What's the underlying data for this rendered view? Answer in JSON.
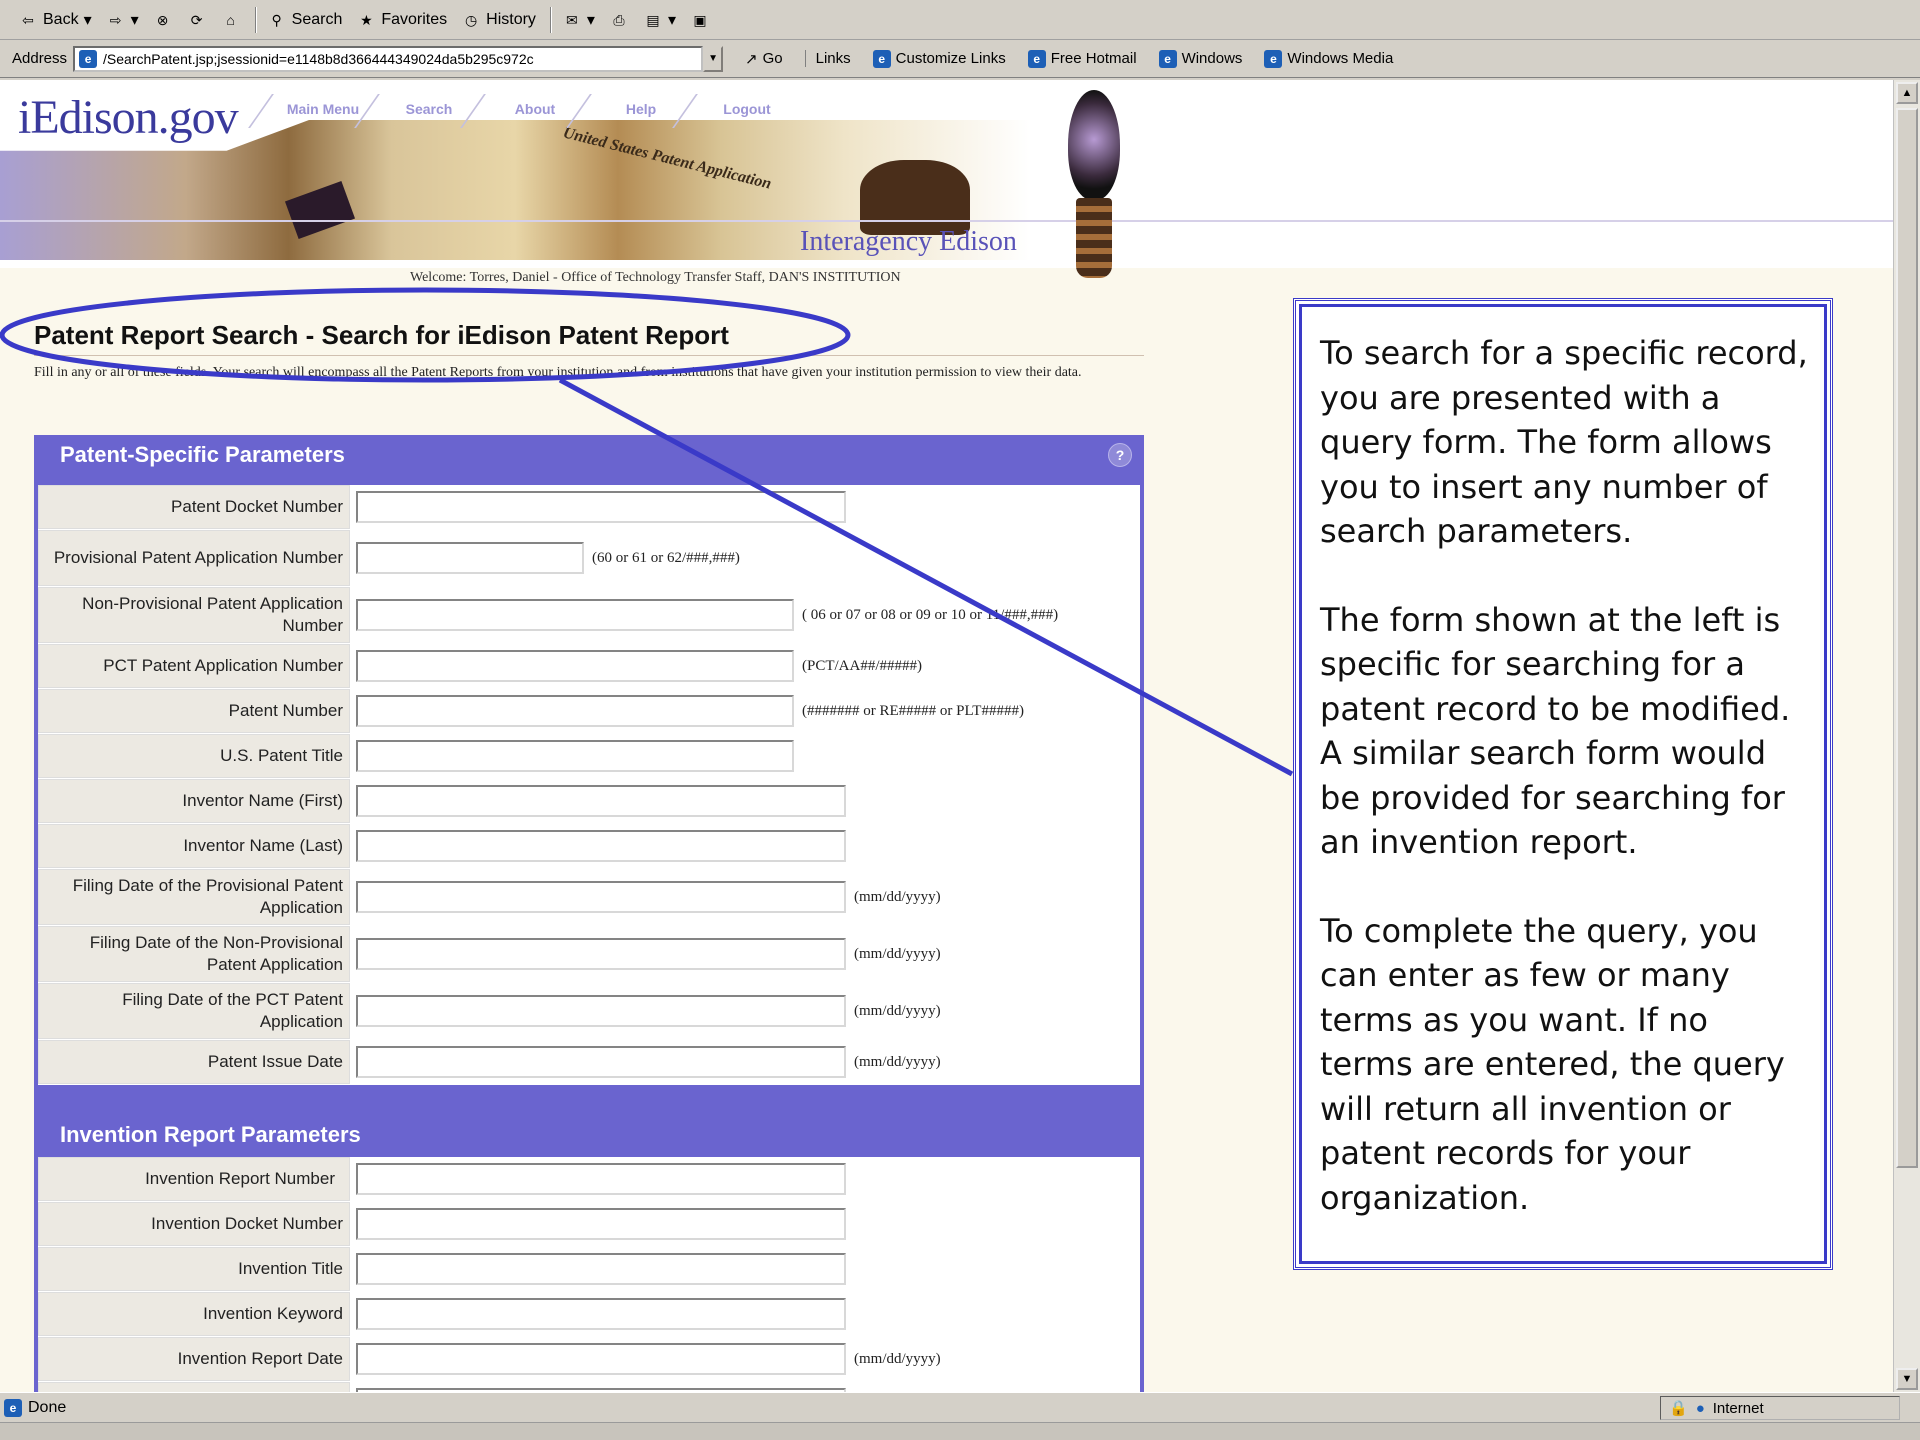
{
  "toolbar": {
    "back": "Back",
    "search": "Search",
    "favorites": "Favorites",
    "history": "History"
  },
  "address": {
    "label": "Address",
    "url": "/SearchPatent.jsp;jsessionid=e1148b8d366444349024da5b295c972c",
    "go": "Go",
    "links_label": "Links",
    "links": [
      "Customize Links",
      "Free Hotmail",
      "Windows",
      "Windows Media"
    ]
  },
  "site": {
    "logo": "iEdison.gov",
    "nav": [
      "Main Menu",
      "Search",
      "About",
      "Help",
      "Logout"
    ],
    "banner_caption": "Interagency Edison",
    "doc_caption": "United States Patent Application",
    "welcome": "Welcome: Torres, Daniel - Office of Technology Transfer Staff, DAN'S INSTITUTION"
  },
  "page": {
    "title": "Patent Report Search - Search for iEdison Patent Report",
    "intro": "Fill in any or all of these fields. Your search will encompass all the Patent Reports from your institution and from institutions that have given your institution permission to view their data."
  },
  "patent_section": {
    "heading": "Patent-Specific Parameters",
    "help_icon": "?",
    "fields": [
      {
        "label": "Patent Docket Number",
        "hint": ""
      },
      {
        "label": "Provisional Patent Application Number",
        "hint": "(60 or 61 or 62/###,###)"
      },
      {
        "label": "Non-Provisional Patent Application Number",
        "hint": "( 06 or 07 or 08 or 09 or 10 or 11/###,###)"
      },
      {
        "label": "PCT Patent Application Number",
        "hint": "(PCT/AA##/#####)"
      },
      {
        "label": "Patent Number",
        "hint": "(#######  or RE#####  or PLT#####)"
      },
      {
        "label": "U.S. Patent Title",
        "hint": ""
      },
      {
        "label": "Inventor Name (First)",
        "hint": ""
      },
      {
        "label": "Inventor Name (Last)",
        "hint": ""
      },
      {
        "label": "Filing Date of the Provisional Patent Application",
        "hint": "(mm/dd/yyyy)"
      },
      {
        "label": "Filing Date of the Non-Provisional Patent Application",
        "hint": "(mm/dd/yyyy)"
      },
      {
        "label": "Filing Date of the PCT Patent Application",
        "hint": "(mm/dd/yyyy)"
      },
      {
        "label": "Patent Issue Date",
        "hint": "(mm/dd/yyyy)"
      }
    ]
  },
  "invention_section": {
    "heading": "Invention Report Parameters",
    "fields": [
      {
        "label": "Invention Report Number",
        "hint": ""
      },
      {
        "label": "Invention Docket Number",
        "hint": ""
      },
      {
        "label": "Invention Title",
        "hint": ""
      },
      {
        "label": "Invention Keyword",
        "hint": ""
      },
      {
        "label": "Invention Report Date",
        "hint": "(mm/dd/yyyy)"
      }
    ]
  },
  "callout": {
    "paragraphs": [
      "To search for a specific record, you are presented with a query form.  The form allows you to insert any number of search parameters.",
      "The form shown at the left is specific for searching for a patent record to be modified.  A similar search form would be provided for searching for an invention report.",
      "To complete the query, you can enter as few or many terms as you want.  If no terms are entered, the query will return all invention or patent records for your organization."
    ],
    "accent_color": "#3a3ac8"
  },
  "status": {
    "text": "Done",
    "zone": "Internet"
  }
}
